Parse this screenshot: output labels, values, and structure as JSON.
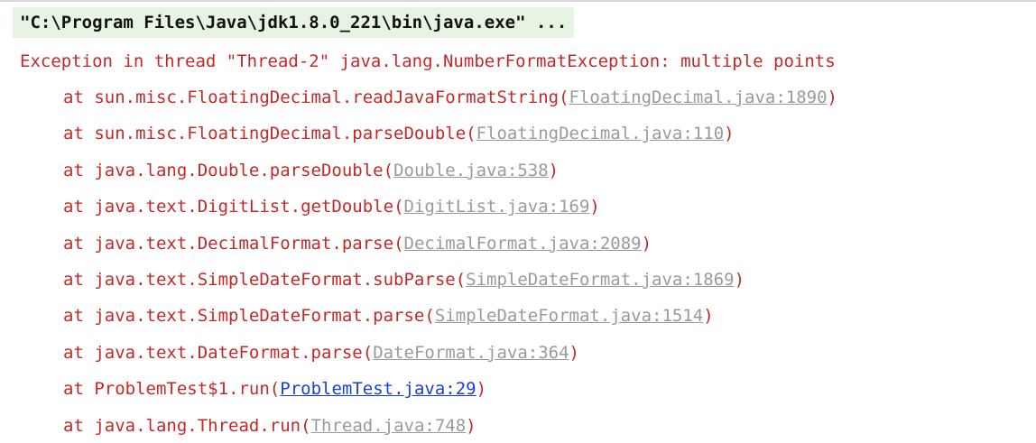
{
  "console": {
    "command_line": "\"C:\\Program Files\\Java\\jdk1.8.0_221\\bin\\java.exe\" ...",
    "exception_message": "Exception in thread \"Thread-2\" java.lang.NumberFormatException: multiple points",
    "frames": [
      {
        "prefix": "at ",
        "method": "sun.misc.FloatingDecimal.readJavaFormatString",
        "location": "FloatingDecimal.java:1890",
        "user_code": false
      },
      {
        "prefix": "at ",
        "method": "sun.misc.FloatingDecimal.parseDouble",
        "location": "FloatingDecimal.java:110",
        "user_code": false
      },
      {
        "prefix": "at ",
        "method": "java.lang.Double.parseDouble",
        "location": "Double.java:538",
        "user_code": false
      },
      {
        "prefix": "at ",
        "method": "java.text.DigitList.getDouble",
        "location": "DigitList.java:169",
        "user_code": false
      },
      {
        "prefix": "at ",
        "method": "java.text.DecimalFormat.parse",
        "location": "DecimalFormat.java:2089",
        "user_code": false
      },
      {
        "prefix": "at ",
        "method": "java.text.SimpleDateFormat.subParse",
        "location": "SimpleDateFormat.java:1869",
        "user_code": false
      },
      {
        "prefix": "at ",
        "method": "java.text.SimpleDateFormat.parse",
        "location": "SimpleDateFormat.java:1514",
        "user_code": false
      },
      {
        "prefix": "at ",
        "method": "java.text.DateFormat.parse",
        "location": "DateFormat.java:364",
        "user_code": false
      },
      {
        "prefix": "at ",
        "method": "ProblemTest$1.run",
        "location": "ProblemTest.java:29",
        "user_code": true
      },
      {
        "prefix": "at ",
        "method": "java.lang.Thread.run",
        "location": "Thread.java:748",
        "user_code": false
      }
    ]
  },
  "colors": {
    "error_text": "#c62828",
    "library_link": "#9a9a9a",
    "user_link": "#1a3fd6",
    "command_highlight": "#e7f3e3"
  }
}
